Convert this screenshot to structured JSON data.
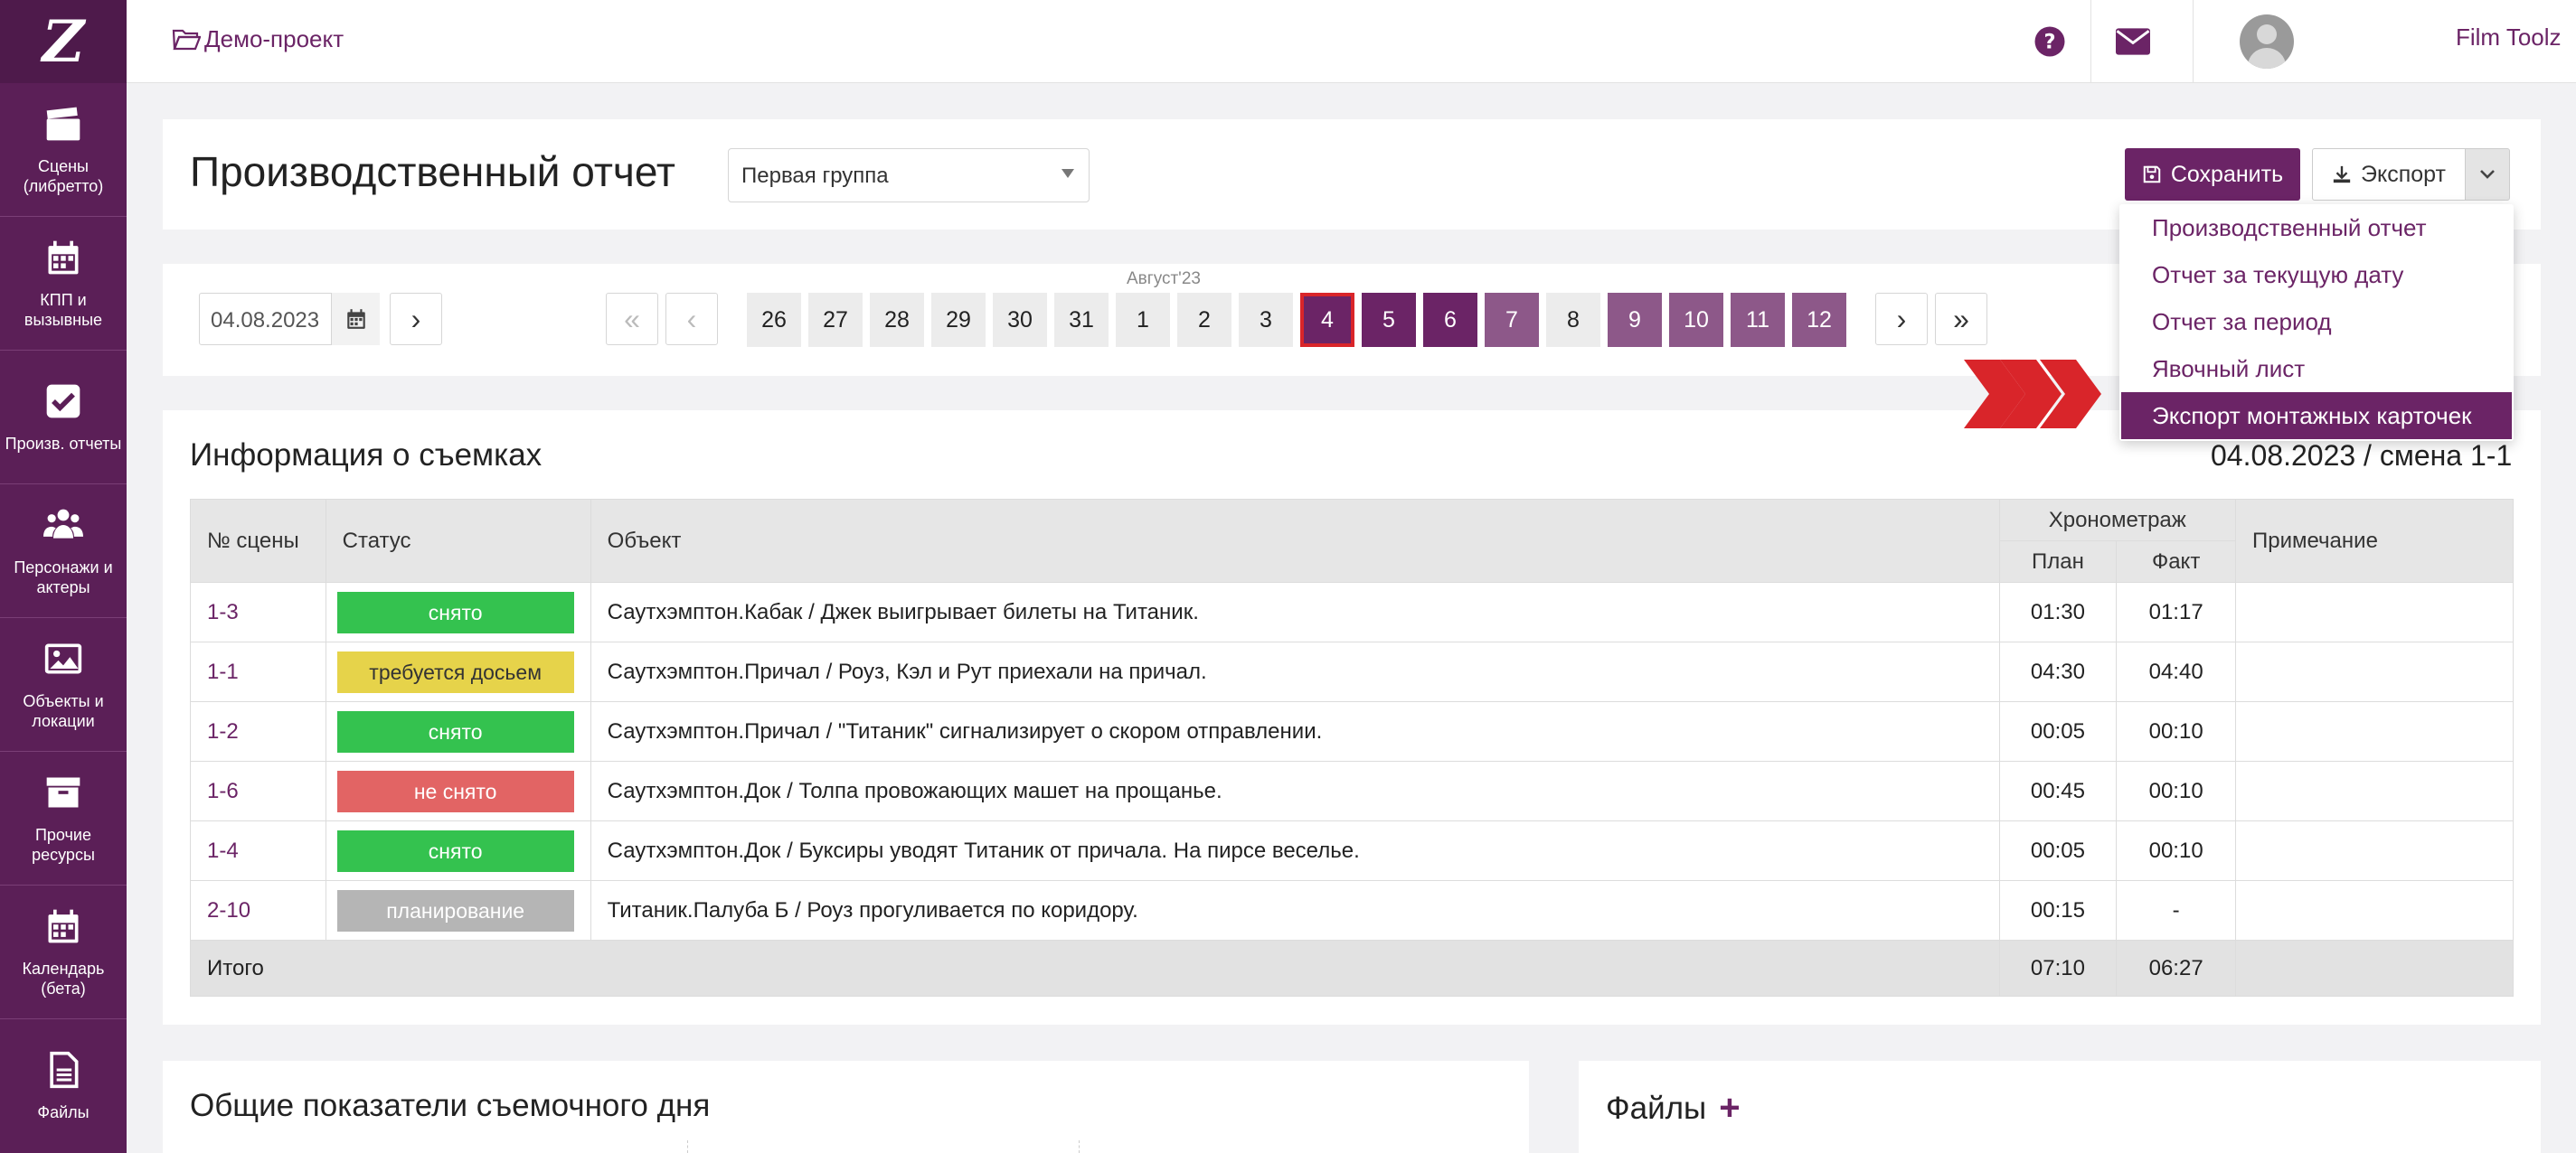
{
  "sidebar": {
    "logo": "Z",
    "items": [
      {
        "label": "Сцены\n(либретто)",
        "icon": "clapperboard-icon"
      },
      {
        "label": "КПП и\nвызывные",
        "icon": "calendar-icon"
      },
      {
        "label": "Произв. отчеты",
        "icon": "checkbox-icon"
      },
      {
        "label": "Персонажи и\nактеры",
        "icon": "users-icon"
      },
      {
        "label": "Объекты и\nлокации",
        "icon": "image-icon"
      },
      {
        "label": "Прочие\nресурсы",
        "icon": "archive-icon"
      },
      {
        "label": "Календарь\n(бета)",
        "icon": "calendar-icon"
      },
      {
        "label": "Файлы",
        "icon": "file-icon"
      }
    ]
  },
  "topbar": {
    "project": "Демо-проект",
    "user_name": "Film Toolz",
    "language": "RU"
  },
  "header": {
    "title": "Производственный отчет",
    "group_select": "Первая группа",
    "save_label": "Сохранить",
    "export_label": "Экспорт"
  },
  "export_menu": {
    "items": [
      "Производственный отчет",
      "Отчет за текущую дату",
      "Отчет за период",
      "Явочный лист",
      "Экспорт монтажных карточек"
    ],
    "active_index": 4
  },
  "date_nav": {
    "date_value": "04.08.2023",
    "month_label": "Август'23",
    "first": "«",
    "prev": "‹",
    "next": "›",
    "last": "»",
    "next_day": "›",
    "days": [
      "26",
      "27",
      "28",
      "29",
      "30",
      "31",
      "1",
      "2",
      "3",
      "4",
      "5",
      "6",
      "7",
      "8",
      "9",
      "10",
      "11",
      "12"
    ]
  },
  "shooting_info": {
    "title": "Информация о съемках",
    "date_shift": "04.08.2023 / смена 1-1",
    "headers": {
      "scene_no": "№ сцены",
      "status": "Статус",
      "object": "Объект",
      "timing": "Хронометраж",
      "plan": "План",
      "fact": "Факт",
      "note": "Примечание"
    },
    "rows": [
      {
        "scene": "1-3",
        "status": "снято",
        "object": "Саутхэмптон.Кабак / Джек выигрывает билеты на Титаник.",
        "plan": "01:30",
        "fact": "01:17",
        "note": ""
      },
      {
        "scene": "1-1",
        "status": "требуется досьем",
        "object": "Саутхэмптон.Причал / Роуз, Кэл и Рут приехали на причал.",
        "plan": "04:30",
        "fact": "04:40",
        "note": ""
      },
      {
        "scene": "1-2",
        "status": "снято",
        "object": "Саутхэмптон.Причал / \"Титаник\" сигнализирует о скором отправлении.",
        "plan": "00:05",
        "fact": "00:10",
        "note": ""
      },
      {
        "scene": "1-6",
        "status": "не снято",
        "object": "Саутхэмптон.Док / Толпа провожающих машет на прощанье.",
        "plan": "00:45",
        "fact": "00:10",
        "note": ""
      },
      {
        "scene": "1-4",
        "status": "снято",
        "object": "Саутхэмптон.Док / Буксиры уводят Титаник от причала. На пирсе веселье.",
        "plan": "00:05",
        "fact": "00:10",
        "note": ""
      },
      {
        "scene": "2-10",
        "status": "планирование",
        "object": "Титаник.Палуба Б / Роуз прогуливается по коридору.",
        "plan": "00:15",
        "fact": "-",
        "note": ""
      }
    ],
    "total": {
      "label": "Итого",
      "plan": "07:10",
      "fact": "06:27"
    }
  },
  "bottom": {
    "left_title": "Общие показатели съемочного дня",
    "right_title": "Файлы",
    "add_symbol": "+"
  },
  "colors": {
    "brand": "#6b2466",
    "status_done": "#34c24f",
    "status_reshoot": "#e6d34a",
    "status_not_done": "#e26464",
    "status_planning": "#b5b5b5",
    "arrow": "#d9252a"
  }
}
